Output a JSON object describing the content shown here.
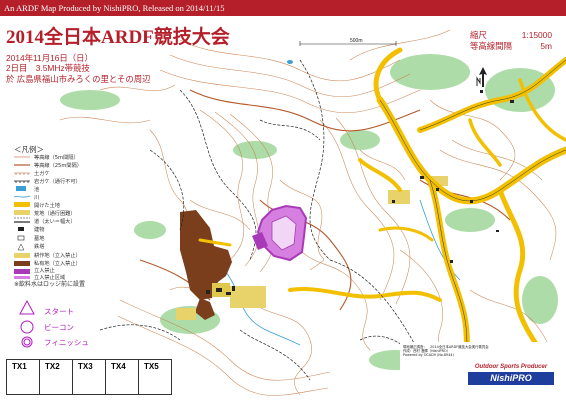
{
  "banner": {
    "text": "An ARDF Map Produced by NishiPRO, Released on 2014/11/15"
  },
  "title": "2014全日本ARDF競技大会",
  "event": {
    "date": "2014年11月16日（日）",
    "day": "2日目　3.5MHz帯競技",
    "place": "於 広島県福山市みろくの里とその周辺"
  },
  "scale": {
    "label": "縮尺",
    "value": "1:15000"
  },
  "contour": {
    "label": "等高線間隔",
    "value": "5m"
  },
  "scale_bar": {
    "label": "500m"
  },
  "legend": {
    "title": "＜凡例＞",
    "items": [
      {
        "label": "等高線（5m間隔）",
        "symbol": "contour"
      },
      {
        "label": "等高線（25m間隔）",
        "symbol": "contour-index"
      },
      {
        "label": "土ガケ",
        "symbol": "earth-bank"
      },
      {
        "label": "岩ガケ（通行不可）",
        "symbol": "cliff"
      },
      {
        "label": "池",
        "symbol": "pond"
      },
      {
        "label": "川",
        "symbol": "stream"
      },
      {
        "label": "開けた土地",
        "symbol": "open-land"
      },
      {
        "label": "荒地（通行困難）",
        "symbol": "rough"
      },
      {
        "label": "道（太い＝幅大）",
        "symbol": "track"
      },
      {
        "label": "建物",
        "symbol": "building"
      },
      {
        "label": "墓地",
        "symbol": "cemetery"
      },
      {
        "label": "鉄塔",
        "symbol": "tower"
      },
      {
        "label": "耕作地（立入禁止）",
        "symbol": "cultivated"
      },
      {
        "label": "私有地（立入禁止）",
        "symbol": "private"
      },
      {
        "label": "立入禁止",
        "symbol": "forbidden"
      },
      {
        "label": "立入禁止区域",
        "symbol": "forbidden-area"
      }
    ],
    "note": "※飲料水はロッジ前に設置"
  },
  "course": [
    {
      "label": "スタート",
      "symbol": "start-triangle"
    },
    {
      "label": "ビーコン",
      "symbol": "beacon-circle"
    },
    {
      "label": "フィニッシュ",
      "symbol": "finish-circle"
    }
  ],
  "transmitters": [
    "TX1",
    "TX2",
    "TX3",
    "TX4",
    "TX5"
  ],
  "credits": [
    "現地補正調査：　2014全日本ARDF競技大会実行委員会",
    "作成：西村 澄輝（NishiPRO）",
    "Powered by OCAD9 (No.8944)"
  ],
  "producer": {
    "tagline": "Outdoor Sports Producer",
    "name": "NishiPRO"
  },
  "colors": {
    "accent": "#b51f2a",
    "road": "#f2c000",
    "forbidden": "#a83ab8",
    "brown": "#7a3e1c",
    "green": "#7cc47c",
    "contour": "#c26a3a",
    "water": "#3a9fd8",
    "producer_bg": "#1f3d9c"
  }
}
